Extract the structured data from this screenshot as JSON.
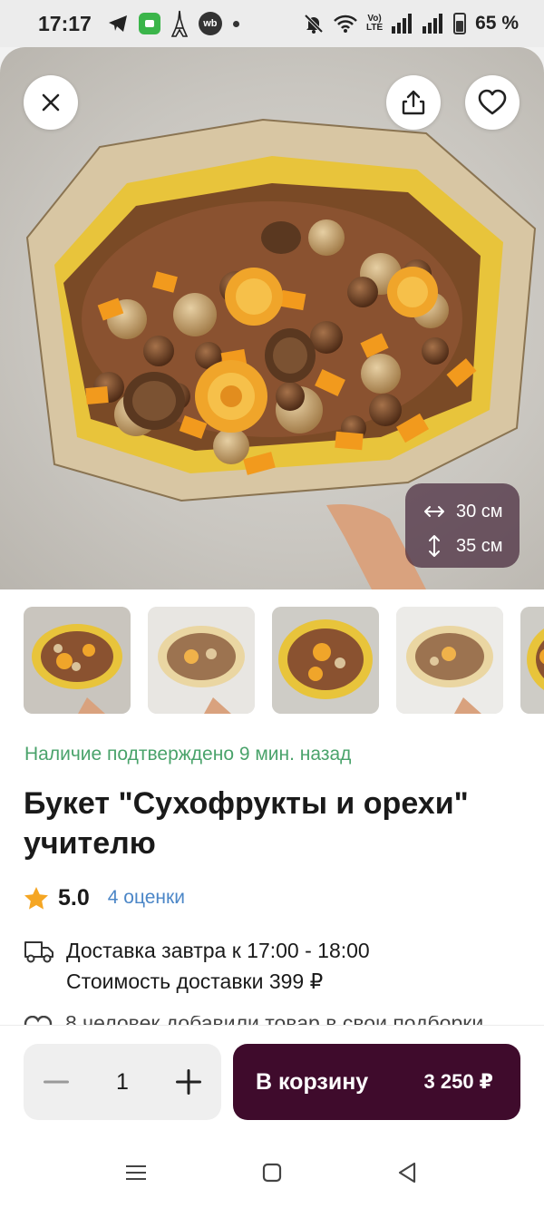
{
  "status_bar": {
    "time": "17:17",
    "wb_badge": "wb",
    "volte_top": "Vo)",
    "volte_bottom": "LTE",
    "battery": "65 %",
    "icons": [
      "telegram-icon",
      "app-badge-icon",
      "eiffel-tower-icon",
      "wb-icon",
      "notification-dot-icon",
      "mute-icon",
      "wifi-icon",
      "volte-icon",
      "signal-icon",
      "battery-icon"
    ]
  },
  "header_actions": {
    "close_icon": "close-icon",
    "share_icon": "share-icon",
    "favorite_icon": "heart-icon"
  },
  "dimensions": {
    "width": "30 см",
    "height": "35 см"
  },
  "thumbnails": {
    "count_visible": 5,
    "active_index": 0
  },
  "product": {
    "availability": "Наличие подтверждено 9 мин. назад",
    "title": "Букет \"Сухофрукты и орехи\" учителю",
    "rating": "5.0",
    "rating_count": "4 оценки",
    "delivery_line1": "Доставка завтра к 17:00 - 18:00",
    "delivery_line2": "Стоимость доставки 399 ₽",
    "peek_text": "8 человек добавили товар в свои подборки"
  },
  "buy_bar": {
    "quantity": "1",
    "cart_label": "В корзину",
    "price": "3 250 ₽"
  },
  "colors": {
    "accent": "#3f0b2c",
    "availability": "#4aa36b",
    "link": "#4b86c7",
    "star": "#f5a623"
  },
  "nav_bar": {
    "icons": [
      "menu-icon",
      "home-square-icon",
      "back-triangle-icon"
    ]
  }
}
